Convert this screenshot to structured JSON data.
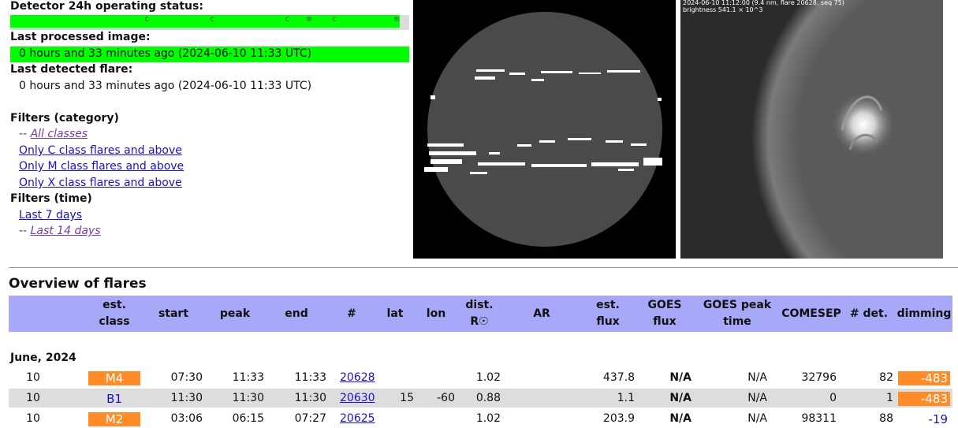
{
  "status": {
    "operating_label": "Detector 24h operating status:",
    "ticks": [
      "c",
      "c",
      "c",
      "m",
      "c",
      "m"
    ],
    "processed_label": "Last processed image:",
    "processed_value": "0 hours and 33 minutes ago (2024-06-10 11:33 UTC)",
    "flare_label": "Last detected flare:",
    "flare_value": "0 hours and 33 minutes ago (2024-06-10 11:33 UTC)"
  },
  "filters": {
    "category_title": "Filters (category)",
    "category_items": [
      "All classes",
      "Only C class flares and above",
      "Only M class flares and above",
      "Only X class flares and above"
    ],
    "time_title": "Filters (time)",
    "time_items": [
      "Last 7 days",
      "Last 14 days"
    ],
    "dash": "--"
  },
  "images": {
    "sun_caption_line1": "2024-06-10 11:12:00 (9.4 nm, flare 20628, seq 75)",
    "sun_caption_line2": "brightness 541.1 × 10^3"
  },
  "overview": {
    "title": "Overview of flares",
    "headers": [
      "est.\nclass",
      "start",
      "peak",
      "end",
      "#",
      "lat",
      "lon",
      "dist.\nR☉",
      "AR",
      "est.\nflux",
      "GOES\nflux",
      "GOES peak\ntime",
      "COMESEP",
      "# det.",
      "dimming"
    ],
    "month": "June, 2024",
    "rows": [
      {
        "day": "10",
        "class": "M4",
        "start": "07:30",
        "peak": "11:33",
        "end": "11:33",
        "num": "20628",
        "lat": "",
        "lon": "",
        "dist": "1.02",
        "ar": "",
        "flux": "437.8",
        "goes_flux": "N/A",
        "goes_peak": "N/A",
        "comesep": "32796",
        "det": "82",
        "dimming": "-483"
      },
      {
        "day": "10",
        "class": "B1",
        "start": "11:30",
        "peak": "11:30",
        "end": "11:30",
        "num": "20630",
        "lat": "15",
        "lon": "-60",
        "dist": "0.88",
        "ar": "",
        "flux": "1.1",
        "goes_flux": "N/A",
        "goes_peak": "N/A",
        "comesep": "0",
        "det": "1",
        "dimming": "-483"
      },
      {
        "day": "10",
        "class": "M2",
        "start": "03:06",
        "peak": "06:15",
        "end": "07:27",
        "num": "20625",
        "lat": "",
        "lon": "",
        "dist": "1.02",
        "ar": "",
        "flux": "203.9",
        "goes_flux": "N/A",
        "goes_peak": "N/A",
        "comesep": "98311",
        "det": "88",
        "dimming": "-19"
      }
    ]
  },
  "colors": {
    "status_green": "#00ff00",
    "header_blue": "#a8a8f8",
    "class_orange": "#ff8c28",
    "row_alt": "#dddddd",
    "link": "#1a12c9"
  }
}
